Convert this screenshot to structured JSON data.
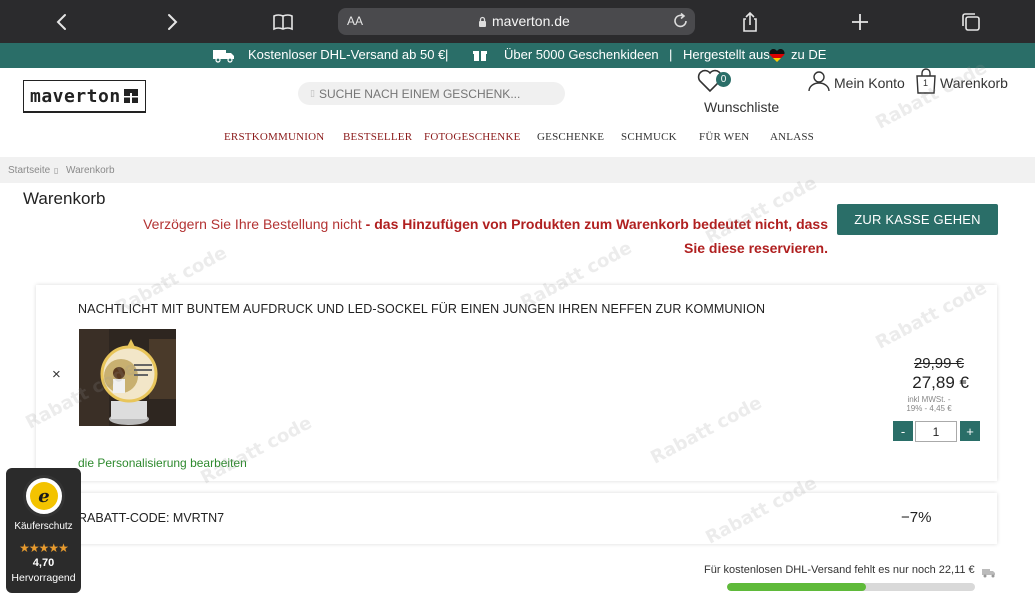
{
  "browser": {
    "aa_label": "AA",
    "url": "maverton.de"
  },
  "promo": {
    "shipping": "Kostenloser DHL-Versand ab 50 €",
    "sep1": "|",
    "gifts": "Über 5000 Geschenkideen",
    "sep2": "|",
    "made_in_prefix": "Hergestellt aus",
    "made_in_suffix": "zu DE"
  },
  "header": {
    "logo_text": "maverton",
    "search_placeholder": "SUCHE NACH EINEM GESCHENK...",
    "wishlist_count": "0",
    "wishlist_label": "Wunschliste",
    "account_label": "Mein Konto",
    "cart_label": "Warenkorb",
    "cart_count": "1"
  },
  "nav": {
    "items": [
      "ERSTKOMMUNION",
      "BESTSELLER",
      "FOTOGESCHENKE",
      "GESCHENKE",
      "SCHMUCK",
      "FÜR WEN",
      "ANLASS"
    ],
    "highlight_color": "#8b1a1a",
    "default_color": "#333333"
  },
  "breadcrumb": {
    "home": "Startseite",
    "separator": "▯",
    "current": "Warenkorb"
  },
  "page": {
    "title": "Warenkorb",
    "notice_light": "Verzögern Sie Ihre Bestellung nicht",
    "notice_bold": " - das Hinzufügen von Produkten zum Warenkorb bedeutet nicht, dass Sie diese reservieren.",
    "checkout_button": "ZUR KASSE GEHEN"
  },
  "cart_item": {
    "title": "NACHTLICHT MIT BUNTEM AUFDRUCK UND LED-SOCKEL FÜR EINEN JUNGEN IHREN NEFFEN ZUR KOMMUNION",
    "remove_symbol": "×",
    "edit_link": "die Personalisierung bearbeiten",
    "price_old": "29,99 €",
    "price_new": "27,89 €",
    "vat_note": "inkl MWSt. - 19% - 4,45 €",
    "qty_minus": "-",
    "qty_value": "1",
    "qty_plus": "+"
  },
  "discount": {
    "label": "RABATT-CODE: MVRTN7",
    "value": "−7%"
  },
  "shipping": {
    "text": "Für kostenlosen DHL-Versand fehlt es nur noch 22,11 €",
    "progress": 0.56
  },
  "trusted_shops": {
    "label": "Käuferschutz",
    "stars": "★★★★★",
    "score": "4,70",
    "grade": "Hervorragend"
  },
  "watermark": "Rabatt code"
}
